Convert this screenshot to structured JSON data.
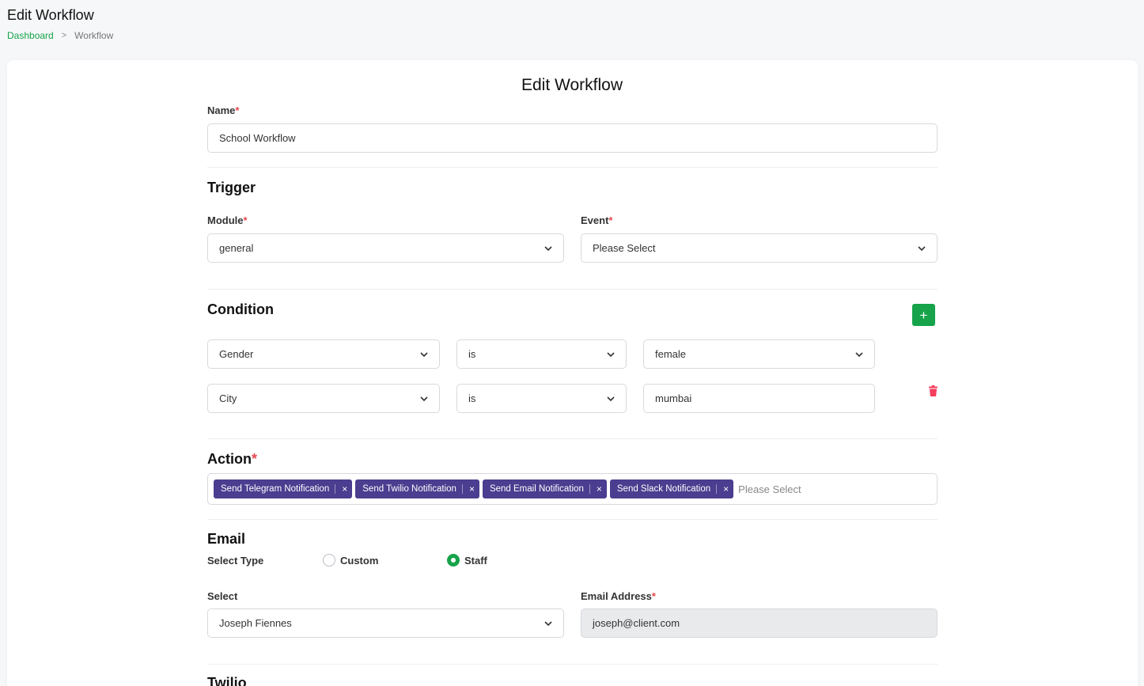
{
  "header": {
    "title": "Edit Workflow",
    "breadcrumb": {
      "home": "Dashboard",
      "separator": ">",
      "current": "Workflow"
    }
  },
  "form": {
    "title": "Edit Workflow",
    "name": {
      "label": "Name",
      "required": "*",
      "value": "School Workflow"
    },
    "trigger": {
      "title": "Trigger",
      "module": {
        "label": "Module",
        "required": "*",
        "value": "general"
      },
      "event": {
        "label": "Event",
        "required": "*",
        "value": "Please Select"
      }
    },
    "condition": {
      "title": "Condition",
      "add_label": "+",
      "rows": [
        {
          "field": "Gender",
          "operator": "is",
          "value": "female"
        },
        {
          "field": "City",
          "operator": "is",
          "value": "mumbai"
        }
      ]
    },
    "action": {
      "title": "Action",
      "required": "*",
      "tags": [
        "Send Telegram Notification",
        "Send Twilio Notification",
        "Send Email Notification",
        "Send Slack Notification"
      ],
      "remove_symbol": "×",
      "placeholder": "Please Select"
    },
    "email": {
      "title": "Email",
      "select_type_label": "Select Type",
      "options": {
        "custom": "Custom",
        "staff": "Staff"
      },
      "selected": "staff",
      "select": {
        "label": "Select",
        "value": "Joseph Fiennes"
      },
      "address": {
        "label": "Email Address",
        "required": "*",
        "value": "joseph@client.com"
      }
    },
    "next_section": {
      "title": "Twilio"
    }
  },
  "colors": {
    "accent": "#16a34a",
    "tag": "#4b3d8f",
    "danger": "#e5484d"
  }
}
